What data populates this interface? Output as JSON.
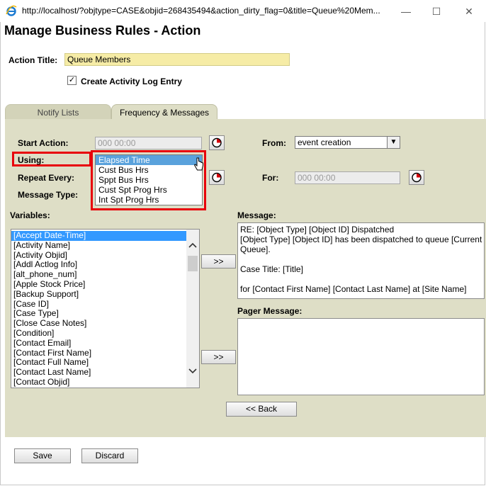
{
  "window": {
    "url": "http://localhost/?objtype=CASE&objid=268435494&action_dirty_flag=0&title=Queue%20Mem...",
    "minimize_glyph": "—",
    "maximize_glyph": "☐",
    "close_glyph": "✕"
  },
  "page": {
    "title": "Manage Business Rules - Action"
  },
  "form": {
    "action_title_label": "Action Title:",
    "action_title_value": "Queue Members",
    "create_log_label": "Create Activity Log Entry",
    "create_log_checked": true
  },
  "tabs": [
    {
      "label": "Notify Lists",
      "active": false
    },
    {
      "label": "Frequency & Messages",
      "active": true
    }
  ],
  "frequency": {
    "start_action_label": "Start Action:",
    "start_action_value": "000 00:00",
    "using_label": "Using:",
    "repeat_every_label": "Repeat Every:",
    "message_type_label": "Message Type:",
    "from_label": "From:",
    "from_value": "event creation",
    "for_label": "For:",
    "for_value": "000 00:00"
  },
  "using_dropdown": {
    "options": [
      "Elapsed Time",
      "Cust Bus Hrs",
      "Sppt Bus Hrs",
      "Cust Spt Prog Hrs",
      "Int Spt Prog Hrs"
    ],
    "selected": "Elapsed Time"
  },
  "variables": {
    "label": "Variables:",
    "items": [
      "[Accept Date-Time]",
      "[Activity Name]",
      "[Activity Objid]",
      "[Addl Actlog Info]",
      "[alt_phone_num]",
      "[Apple Stock Price]",
      "[Backup Support]",
      "[Case ID]",
      "[Case Type]",
      "[Close Case Notes]",
      "[Condition]",
      "[Contact Email]",
      "[Contact First Name]",
      "[Contact Full Name]",
      "[Contact Last Name]",
      "[Contact Objid]"
    ]
  },
  "message": {
    "label": "Message:",
    "lines": [
      "RE: [Object Type] [Object ID] Dispatched",
      "[Object Type] [Object ID] has been dispatched to queue [Current",
      "Queue].",
      "",
      "Case Title: [Title]",
      "",
      "for [Contact First Name] [Contact Last Name] at [Site Name]"
    ]
  },
  "pager": {
    "label": "Pager Message:"
  },
  "buttons": {
    "add_message": ">>",
    "add_pager": ">>",
    "back": "<< Back",
    "save": "Save",
    "discard": "Discard"
  },
  "colors": {
    "panel_bg": "#dedec6",
    "title_input_bg": "#f6eca6",
    "highlight_red": "#e8000b",
    "list_selected": "#3399ff"
  }
}
